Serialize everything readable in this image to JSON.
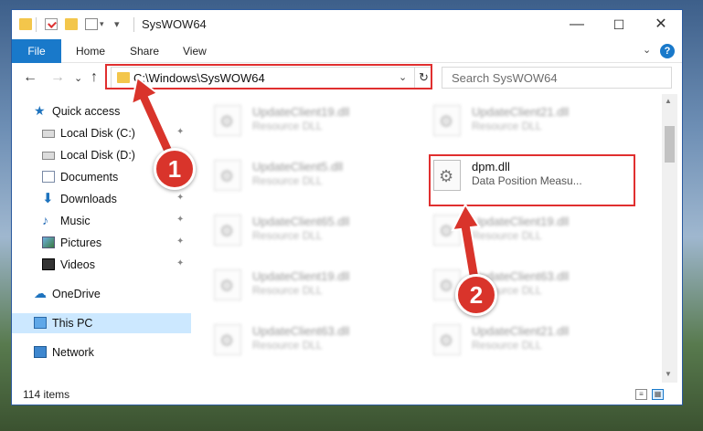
{
  "window": {
    "title": "SysWOW64",
    "minimize": "—",
    "maximize": "☐",
    "close": "✕"
  },
  "ribbon": {
    "tabs": [
      "File",
      "Home",
      "Share",
      "View"
    ],
    "chevron": "⌄",
    "help": "?"
  },
  "nav": {
    "back": "←",
    "forward": "→",
    "up_history": "⌄",
    "up": "↑"
  },
  "address": {
    "path": "C:\\Windows\\SysWOW64",
    "dropdown": "⌄",
    "refresh": "↻"
  },
  "search": {
    "placeholder": "Search SysWOW64"
  },
  "sidebar": {
    "items": [
      {
        "label": "Quick access",
        "icon": "star-icon",
        "pinned": false
      },
      {
        "label": "Local Disk (C:)",
        "icon": "drive-icon",
        "pinned": true
      },
      {
        "label": "Local Disk (D:)",
        "icon": "drive-icon",
        "pinned": false
      },
      {
        "label": "Documents",
        "icon": "documents-icon",
        "pinned": true
      },
      {
        "label": "Downloads",
        "icon": "download-icon",
        "pinned": true
      },
      {
        "label": "Music",
        "icon": "music-icon",
        "pinned": true
      },
      {
        "label": "Pictures",
        "icon": "pictures-icon",
        "pinned": true
      },
      {
        "label": "Videos",
        "icon": "videos-icon",
        "pinned": true
      },
      {
        "label": "OneDrive",
        "icon": "cloud-icon",
        "pinned": false
      },
      {
        "label": "This PC",
        "icon": "computer-icon",
        "pinned": false,
        "selected": true
      },
      {
        "label": "Network",
        "icon": "network-icon",
        "pinned": false
      }
    ],
    "pin_glyph": "📌"
  },
  "files": [
    {
      "name": "UpdateClient19.dll",
      "desc": "Resource DLL"
    },
    {
      "name": "UpdateClient21.dll",
      "desc": "Resource DLL"
    },
    {
      "name": "UpdateClient5.dll",
      "desc": "Resource DLL"
    },
    {
      "name": "dpm.dll",
      "desc": "Data Position Measu...",
      "highlighted": true
    },
    {
      "name": "UpdateClient65.dll",
      "desc": "Resource DLL"
    },
    {
      "name": "UpdateClient19.dll",
      "desc": "Resource DLL"
    },
    {
      "name": "UpdateClient19.dll",
      "desc": "Resource DLL"
    },
    {
      "name": "UpdateClient63.dll",
      "desc": "Resource DLL"
    },
    {
      "name": "UpdateClient63.dll",
      "desc": "Resource DLL"
    },
    {
      "name": "UpdateClient21.dll",
      "desc": "Resource DLL"
    }
  ],
  "status": {
    "count": "114 items"
  },
  "annotations": {
    "step1": "1",
    "step2": "2",
    "color": "#e02f2f"
  },
  "colors": {
    "accent": "#1979ca",
    "selection": "#cce8ff",
    "annotation_red": "#d9342b"
  }
}
